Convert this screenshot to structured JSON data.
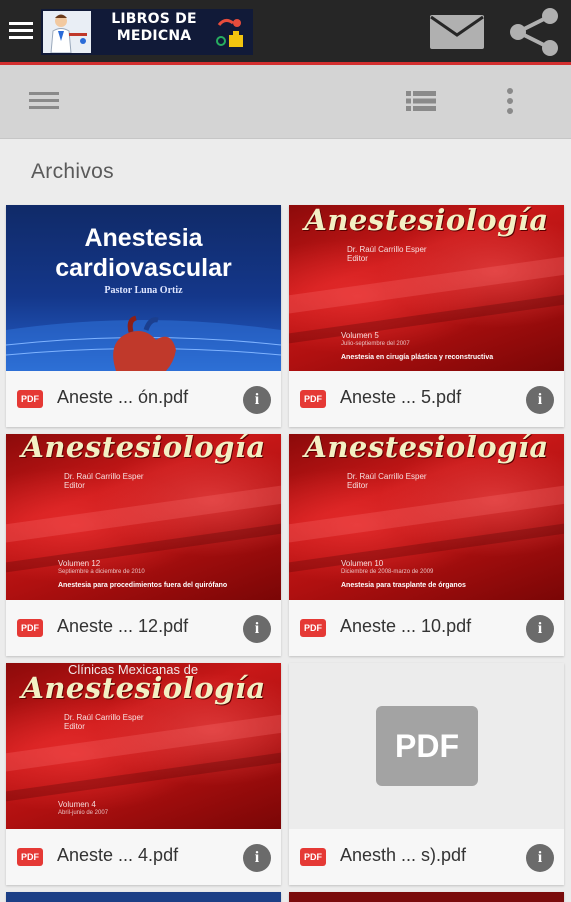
{
  "appbar": {
    "banner_title": "LIBROS DE MEDICNA",
    "icons": {
      "menu": "menu-icon",
      "mail": "mail-icon",
      "share": "share-icon"
    },
    "colors": {
      "background": "#262626",
      "accent": "#d32f2f"
    }
  },
  "toolbar": {
    "icons": {
      "drawer": "drawer-icon",
      "list_view": "list-view-icon",
      "more": "more-vert-icon"
    }
  },
  "section": {
    "title": "Archivos"
  },
  "cards": [
    {
      "filename": "Aneste ... ón.pdf",
      "badge": "PDF",
      "thumb": {
        "kind": "blue",
        "title": "Anestesia cardiovascular",
        "author": "Pastor Luna Ortiz"
      }
    },
    {
      "filename": "Aneste ... 5.pdf",
      "badge": "PDF",
      "thumb": {
        "kind": "red",
        "title": "Anestesiología",
        "editor": "Dr. Raúl Carrillo Esper",
        "editor_role": "Editor",
        "volume": "Volumen 5",
        "date": "Julio-septiembre del 2007",
        "topic": "Anestesia en cirugía plástica y reconstructiva"
      }
    },
    {
      "filename": "Aneste ... 12.pdf",
      "badge": "PDF",
      "thumb": {
        "kind": "red",
        "title": "Anestesiología",
        "editor": "Dr. Raúl Carrillo Esper",
        "editor_role": "Editor",
        "volume": "Volumen 12",
        "date": "Septiembre a diciembre de 2010",
        "topic": "Anestesia para procedimientos fuera del quirófano"
      }
    },
    {
      "filename": "Aneste ... 10.pdf",
      "badge": "PDF",
      "thumb": {
        "kind": "red",
        "title": "Anestesiología",
        "editor": "Dr. Raúl Carrillo Esper",
        "editor_role": "Editor",
        "volume": "Volumen 10",
        "date": "Diciembre de 2008-marzo de 2009",
        "topic": "Anestesia para trasplante de órganos"
      }
    },
    {
      "filename": "Aneste ... 4.pdf",
      "badge": "PDF",
      "thumb": {
        "kind": "red",
        "clinic": "Clínicas Mexicanas de",
        "title": "Anestesiología",
        "editor": "Dr. Raúl Carrillo Esper",
        "editor_role": "Editor",
        "volume": "Volumen 4",
        "date": "Abril-junio de 2007"
      }
    },
    {
      "filename": "Anesth ... s).pdf",
      "badge": "PDF",
      "thumb": {
        "kind": "placeholder",
        "label": "PDF"
      }
    }
  ]
}
